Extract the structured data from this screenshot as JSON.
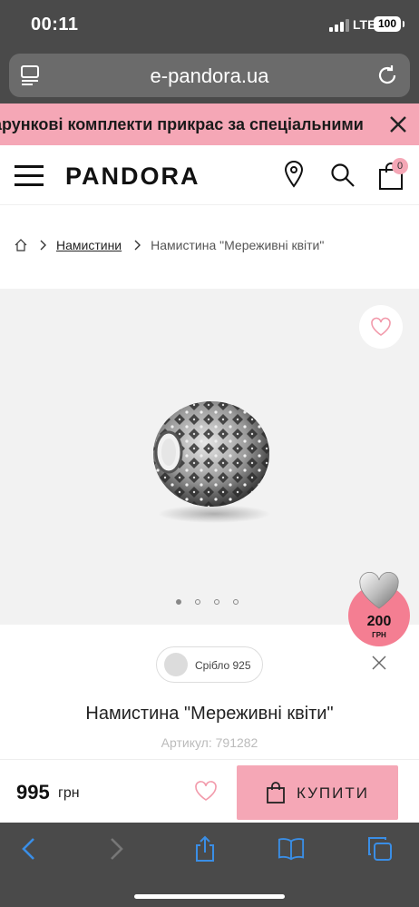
{
  "status_bar": {
    "time": "00:11",
    "network": "LTE",
    "battery": "100"
  },
  "browser": {
    "domain": "e-pandora.ua"
  },
  "promo_banner": {
    "text": "арункові комплекти прикрас за спеціальними"
  },
  "header": {
    "logo": "PANDORA",
    "cart_count": "0"
  },
  "breadcrumb": {
    "category": "Намистини",
    "current": "Намистина \"Мереживні квіти\""
  },
  "gallery": {
    "image_count": 4,
    "active_index": 0
  },
  "gift_badge": {
    "amount": "200",
    "currency": "ГРН"
  },
  "product": {
    "material": "Срібло 925",
    "title": "Намистина \"Мереживні квіти\"",
    "sku_label": "Артикул:",
    "sku": "791282"
  },
  "buy_bar": {
    "price": "995",
    "currency": "грн",
    "buy_label": "КУПИТИ"
  },
  "colors": {
    "accent_pink": "#f5a7b6",
    "gift_pink": "#f47e92",
    "chrome": "#4a4a4a",
    "ios_blue": "#3a8ee6"
  }
}
